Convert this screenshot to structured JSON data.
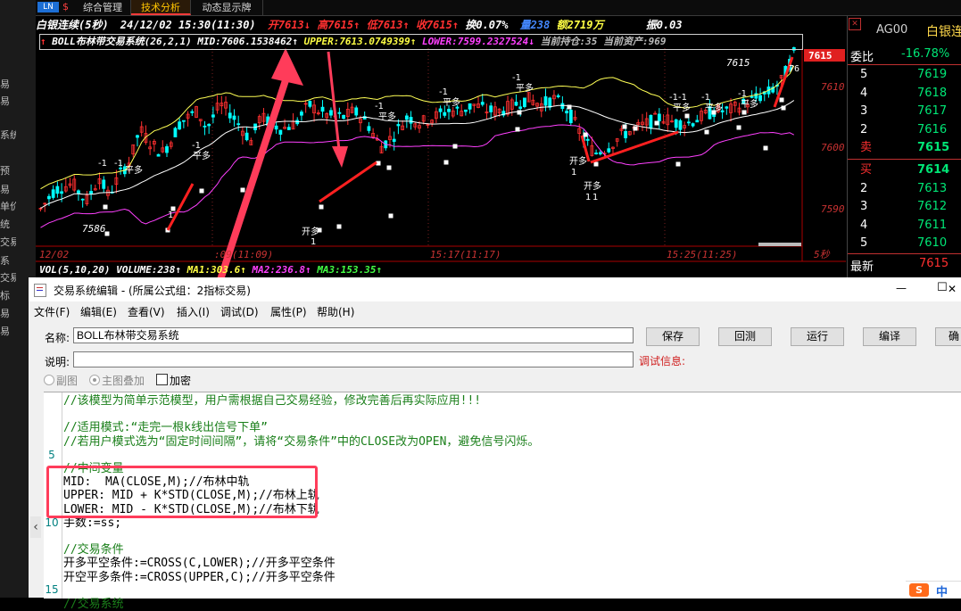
{
  "left_sidebar": {
    "labels": [
      "易",
      "易",
      "系统",
      "预",
      "易",
      "单价",
      "统",
      "交易",
      "系",
      "交易",
      "标",
      "易",
      "易"
    ]
  },
  "tabs": {
    "icon_text": "LN",
    "items": [
      "综合管理",
      "技术分析",
      "动态显示牌"
    ],
    "active_index": 1
  },
  "chart": {
    "info_line": {
      "name": "白银连续(5秒)",
      "datetime": "24/12/02 15:30(11:30)",
      "open": "开7613↓",
      "high": "高7615↑",
      "low": "低7613↑",
      "close": "收7615↑",
      "turnover": "换0.07%",
      "volume": "量238",
      "amount": "额2719万",
      "extra": "振0.03"
    },
    "indicator_line": {
      "arrow": "↑",
      "name": "BOLL布林带交易系统(26,2,1)",
      "mid": "MID:7606.1538462↑",
      "upper": "UPPER:7613.0749399↑",
      "lower": "LOWER:7599.2327524↓",
      "position": "当前持仓:35",
      "assets": "当前资产:969"
    },
    "x_labels": [
      "12/02",
      ":09(11:09)",
      "15:17(11:17)",
      "15:25(11:25)"
    ],
    "x_unit": "5秒",
    "y_labels": [
      "7615",
      "7610",
      "7600",
      "7590"
    ],
    "chart_labels": [
      "7615",
      "7586",
      "75",
      "76"
    ],
    "signals": [
      "-1",
      "平多",
      "开多",
      "1"
    ],
    "volume_line": {
      "vol": "VOL(5,10,20)",
      "volume": "VOLUME:238↑",
      "ma1": "MA1:303.6↑",
      "ma2": "MA2:236.8↑",
      "ma3": "MA3:153.35↑"
    },
    "colors": {
      "up": "#ff3030",
      "down": "#00ffff",
      "mid": "#ffffff",
      "upper": "#ffff55",
      "lower": "#ff40ff",
      "axis": "#aa0000",
      "annotation": "#ff3c5a"
    }
  },
  "quote_panel": {
    "code": "AG00",
    "name": "白银连",
    "weibi_label": "委比",
    "weibi_value": "-16.78%",
    "sell_rows": [
      {
        "level": "5",
        "price": "7619"
      },
      {
        "level": "4",
        "price": "7618"
      },
      {
        "level": "3",
        "price": "7617"
      },
      {
        "level": "2",
        "price": "7616"
      },
      {
        "level": "卖",
        "price": "7615"
      }
    ],
    "buy_rows": [
      {
        "level": "买",
        "price": "7614"
      },
      {
        "level": "2",
        "price": "7613"
      },
      {
        "level": "3",
        "price": "7612"
      },
      {
        "level": "4",
        "price": "7611"
      },
      {
        "level": "5",
        "price": "7610"
      }
    ],
    "latest_label": "最新",
    "latest_value": "7615"
  },
  "editor": {
    "title": "交易系统编辑 - (所属公式组：2指标交易)",
    "menu": [
      "文件(F)",
      "编辑(E)",
      "查看(V)",
      "插入(I)",
      "调试(D)",
      "属性(P)",
      "帮助(H)"
    ],
    "name_label": "名称:",
    "name_value": "BOLL布林带交易系统",
    "desc_label": "说明:",
    "desc_value": "",
    "buttons": {
      "save": "保存",
      "backtest": "回测",
      "run": "运行",
      "compile": "编译",
      "confirm": "确"
    },
    "debug_label": "调试信息:",
    "radio_sub": "副图",
    "radio_main": "主图叠加",
    "encrypt": "加密",
    "code_lines": [
      {
        "text": "//该模型为简单示范模型，用户需根据自己交易经验，修改完善后再实际应用!!!",
        "kind": "comment"
      },
      {
        "text": "",
        "kind": "plain"
      },
      {
        "text": "//适用模式:“走完一根k线出信号下单”",
        "kind": "comment"
      },
      {
        "text": "//若用户模式选为“固定时间间隔”，请将“交易条件”中的CLOSE改为OPEN，避免信号闪烁。",
        "kind": "comment"
      },
      {
        "text": "",
        "kind": "plain"
      },
      {
        "text": "//中间变量",
        "kind": "comment"
      },
      {
        "text": "MID:  MA(CLOSE,M);//布林中轨",
        "kind": "code"
      },
      {
        "text": "UPPER: MID + K*STD(CLOSE,M);//布林上轨",
        "kind": "code"
      },
      {
        "text": "LOWER: MID - K*STD(CLOSE,M);//布林下轨",
        "kind": "code"
      },
      {
        "text": "手数:=ss;",
        "kind": "plain"
      },
      {
        "text": "",
        "kind": "plain"
      },
      {
        "text": "//交易条件",
        "kind": "comment"
      },
      {
        "text": "开多平空条件:=CROSS(C,LOWER);//开多平空条件",
        "kind": "code"
      },
      {
        "text": "开空平多条件:=CROSS(UPPER,C);//开多平空条件",
        "kind": "code"
      },
      {
        "text": "",
        "kind": "plain"
      },
      {
        "text": "//交易系统",
        "kind": "comment"
      }
    ],
    "gutter_numbers": [
      "5",
      "10",
      "15"
    ],
    "scroll_arrow": "‹",
    "ime_label": "中"
  },
  "window_controls": {
    "minimize": "—",
    "maximize": "☐",
    "close": "✕"
  }
}
